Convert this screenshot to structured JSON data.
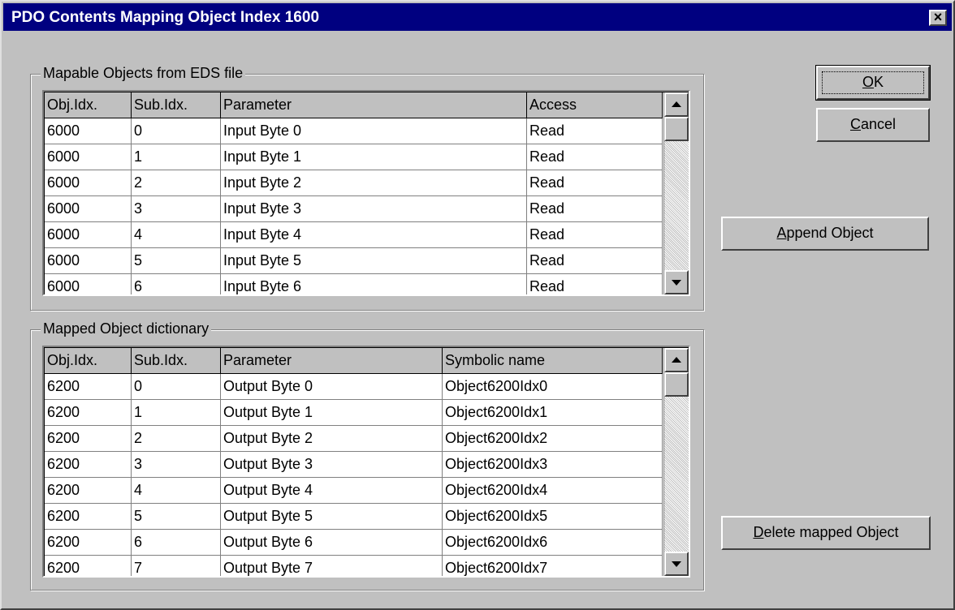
{
  "window": {
    "title": "PDO Contents Mapping Object Index 1600",
    "close_label": "×"
  },
  "buttons": {
    "ok": {
      "accel": "O",
      "rest": "K"
    },
    "cancel": {
      "accel": "C",
      "rest": "ancel"
    },
    "append": {
      "accel": "A",
      "rest": "ppend Object"
    },
    "delete": {
      "accel": "D",
      "rest": "elete mapped Object"
    }
  },
  "mapable": {
    "label": "Mapable Objects from EDS file",
    "columns": [
      "Obj.Idx.",
      "Sub.Idx.",
      "Parameter",
      "Access"
    ],
    "rows": [
      [
        "6000",
        "0",
        "Input Byte 0",
        "Read"
      ],
      [
        "6000",
        "1",
        "Input Byte 1",
        "Read"
      ],
      [
        "6000",
        "2",
        "Input Byte 2",
        "Read"
      ],
      [
        "6000",
        "3",
        "Input Byte 3",
        "Read"
      ],
      [
        "6000",
        "4",
        "Input Byte 4",
        "Read"
      ],
      [
        "6000",
        "5",
        "Input Byte 5",
        "Read"
      ],
      [
        "6000",
        "6",
        "Input Byte 6",
        "Read"
      ]
    ]
  },
  "mapped": {
    "label": "Mapped Object dictionary",
    "columns": [
      "Obj.Idx.",
      "Sub.Idx.",
      "Parameter",
      "Symbolic name"
    ],
    "rows": [
      [
        "6200",
        "0",
        "Output Byte 0",
        "Object6200Idx0"
      ],
      [
        "6200",
        "1",
        "Output Byte 1",
        "Object6200Idx1"
      ],
      [
        "6200",
        "2",
        "Output Byte 2",
        "Object6200Idx2"
      ],
      [
        "6200",
        "3",
        "Output Byte 3",
        "Object6200Idx3"
      ],
      [
        "6200",
        "4",
        "Output Byte 4",
        "Object6200Idx4"
      ],
      [
        "6200",
        "5",
        "Output Byte 5",
        "Object6200Idx5"
      ],
      [
        "6200",
        "6",
        "Output Byte 6",
        "Object6200Idx6"
      ],
      [
        "6200",
        "7",
        "Output Byte 7",
        "Object6200Idx7"
      ]
    ]
  }
}
